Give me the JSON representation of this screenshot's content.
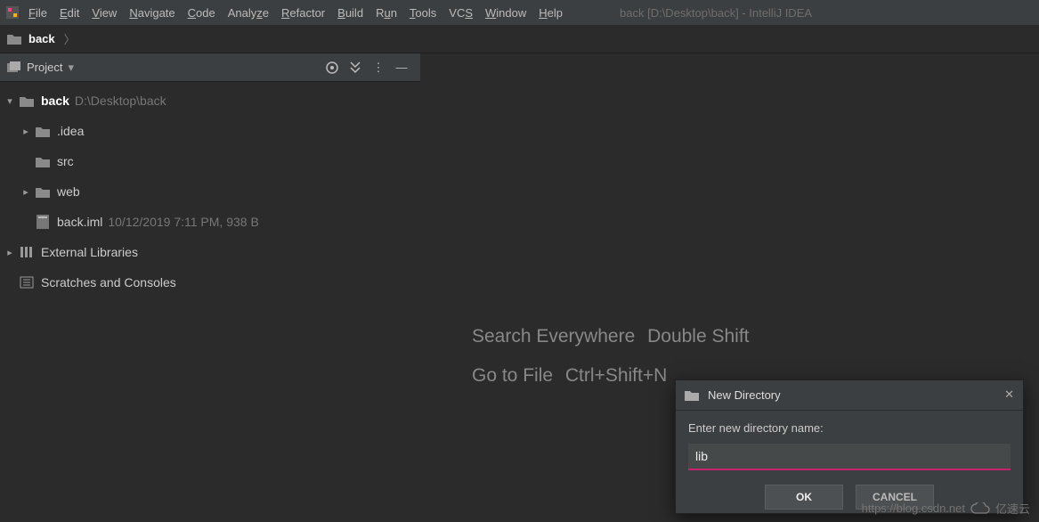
{
  "menubar": {
    "items": [
      "File",
      "Edit",
      "View",
      "Navigate",
      "Code",
      "Analyze",
      "Refactor",
      "Build",
      "Run",
      "Tools",
      "VCS",
      "Window",
      "Help"
    ],
    "title": "back [D:\\Desktop\\back] - IntelliJ IDEA"
  },
  "breadcrumb": {
    "project": "back"
  },
  "toolwindow": {
    "name": "Project"
  },
  "tree": {
    "root": {
      "name": "back",
      "path": "D:\\Desktop\\back"
    },
    "children": [
      {
        "name": ".idea",
        "expandable": true
      },
      {
        "name": "src",
        "expandable": false
      },
      {
        "name": "web",
        "expandable": true
      },
      {
        "name": "back.iml",
        "meta": "10/12/2019 7:11 PM, 938 B",
        "expandable": false
      }
    ],
    "external": "External Libraries",
    "scratches": "Scratches and Consoles"
  },
  "hints": {
    "search": {
      "label": "Search Everywhere",
      "key": "Double Shift"
    },
    "goto": {
      "label": "Go to File",
      "key": "Ctrl+Shift+N"
    }
  },
  "dialog": {
    "title": "New Directory",
    "prompt": "Enter new directory name:",
    "value": "lib",
    "ok": "OK",
    "cancel": "CANCEL"
  },
  "watermark": {
    "url": "https://blog.csdn.net",
    "brand": "亿速云"
  }
}
